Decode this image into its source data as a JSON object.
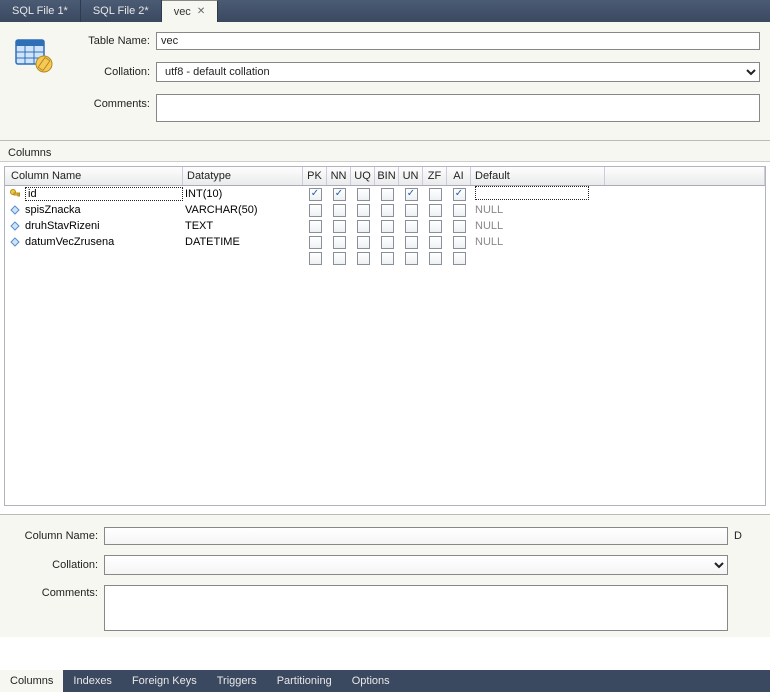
{
  "tabs": [
    {
      "label": "SQL File 1*",
      "active": false
    },
    {
      "label": "SQL File 2*",
      "active": false
    },
    {
      "label": "vec",
      "active": true
    }
  ],
  "header": {
    "tableNameLabel": "Table Name:",
    "tableNameValue": "vec",
    "collationLabel": "Collation:",
    "collationValue": "utf8 - default collation",
    "commentsLabel": "Comments:",
    "commentsValue": ""
  },
  "columnsSectionTitle": "Columns",
  "gridHeaders": {
    "colname": "Column Name",
    "datatype": "Datatype",
    "pk": "PK",
    "nn": "NN",
    "uq": "UQ",
    "bin": "BIN",
    "un": "UN",
    "zf": "ZF",
    "ai": "AI",
    "default": "Default"
  },
  "columns": [
    {
      "icon": "key",
      "name": "id",
      "datatype": "INT(10)",
      "pk": true,
      "nn": true,
      "uq": false,
      "bin": false,
      "un": true,
      "zf": false,
      "ai": true,
      "default": "",
      "editing": true
    },
    {
      "icon": "diamond",
      "name": "spisZnacka",
      "datatype": "VARCHAR(50)",
      "pk": false,
      "nn": false,
      "uq": false,
      "bin": false,
      "un": false,
      "zf": false,
      "ai": false,
      "default": "NULL",
      "editing": false
    },
    {
      "icon": "diamond",
      "name": "druhStavRizeni",
      "datatype": "TEXT",
      "pk": false,
      "nn": false,
      "uq": false,
      "bin": false,
      "un": false,
      "zf": false,
      "ai": false,
      "default": "NULL",
      "editing": false
    },
    {
      "icon": "diamond",
      "name": "datumVecZrusena",
      "datatype": "DATETIME",
      "pk": false,
      "nn": false,
      "uq": false,
      "bin": false,
      "un": false,
      "zf": false,
      "ai": false,
      "default": "NULL",
      "editing": false
    }
  ],
  "details": {
    "columnNameLabel": "Column Name:",
    "columnNameValue": "",
    "datatypeSideLabel": "D",
    "collationLabel": "Collation:",
    "collationValue": "",
    "commentsLabel": "Comments:",
    "commentsValue": ""
  },
  "bottomTabs": [
    {
      "label": "Columns",
      "active": true
    },
    {
      "label": "Indexes",
      "active": false
    },
    {
      "label": "Foreign Keys",
      "active": false
    },
    {
      "label": "Triggers",
      "active": false
    },
    {
      "label": "Partitioning",
      "active": false
    },
    {
      "label": "Options",
      "active": false
    }
  ]
}
